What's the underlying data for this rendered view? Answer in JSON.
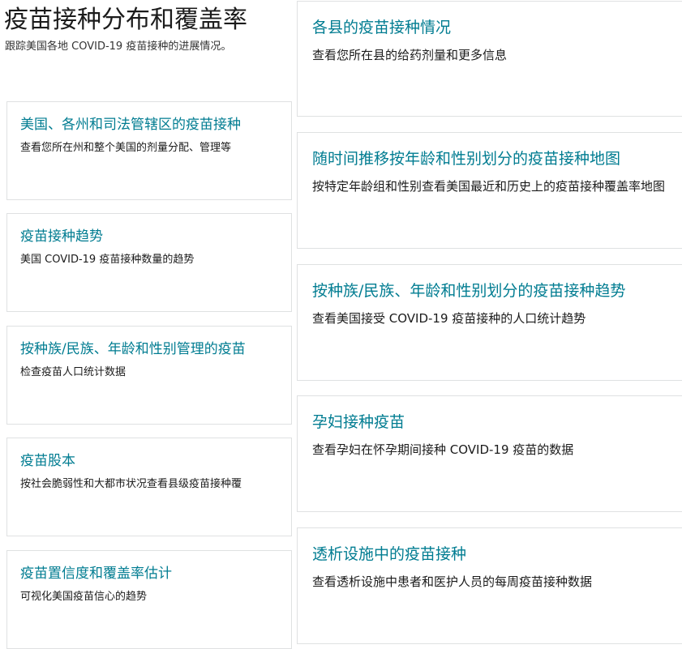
{
  "header": {
    "title": "疫苗接种分布和覆盖率",
    "subtitle": "跟踪美国各地 COVID-19 疫苗接种的进展情况。"
  },
  "left_cards": [
    {
      "title": "美国、各州和司法管辖区的疫苗接种",
      "description": "查看您所在州和整个美国的剂量分配、管理等"
    },
    {
      "title": "疫苗接种趋势",
      "description": "美国 COVID-19 疫苗接种数量的趋势"
    },
    {
      "title": "按种族/民族、年龄和性别管理的疫苗",
      "description": "检查疫苗人口统计数据"
    },
    {
      "title": "疫苗股本",
      "description": "按社会脆弱性和大都市状况查看县级疫苗接种覆"
    },
    {
      "title": "疫苗置信度和覆盖率估计",
      "description": "可视化美国疫苗信心的趋势"
    }
  ],
  "right_cards": [
    {
      "title": "各县的疫苗接种情况",
      "description": "查看您所在县的给药剂量和更多信息"
    },
    {
      "title": "随时间推移按年龄和性别划分的疫苗接种地图",
      "description": "按特定年龄组和性别查看美国最近和历史上的疫苗接种覆盖率地图"
    },
    {
      "title": "按种族/民族、年龄和性别划分的疫苗接种趋势",
      "description": "查看美国接受 COVID-19 疫苗接种的人口统计趋势"
    },
    {
      "title": "孕妇接种疫苗",
      "description": "查看孕妇在怀孕期间接种 COVID-19 疫苗的数据"
    },
    {
      "title": "透析设施中的疫苗接种",
      "description": "查看透析设施中患者和医护人员的每周疫苗接种数据"
    }
  ],
  "colors": {
    "link": "#007c91",
    "border": "#dfe1e2",
    "text": "#1b1b1b"
  }
}
